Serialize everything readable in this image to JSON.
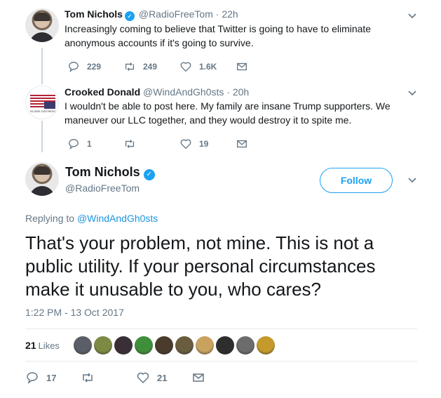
{
  "tweets": [
    {
      "name": "Tom Nichols",
      "verified": true,
      "handle": "@RadioFreeTom",
      "separator": "·",
      "time": "22h",
      "text": "Increasingly coming to believe that Twitter is going to have to eliminate anonymous accounts if it's going to survive.",
      "replies": "229",
      "retweets": "249",
      "likes": "1.6K"
    },
    {
      "name": "Crooked Donald",
      "verified": false,
      "handle": "@WindAndGh0sts",
      "separator": "·",
      "time": "20h",
      "avatar_caption": "IN DIRE DISTRESS",
      "text": "I wouldn't be able to post here. My family are insane Trump supporters. We maneuver our LLC together, and they would destroy it to spite me.",
      "replies": "1",
      "retweets": "",
      "likes": "19"
    }
  ],
  "main_tweet": {
    "name": "Tom Nichols",
    "verified": true,
    "handle": "@RadioFreeTom",
    "follow_label": "Follow",
    "replying_prefix": "Replying to ",
    "replying_to": "@WindAndGh0sts",
    "text": "That's your problem, not mine. This is not a public utility. If your personal circumstances make it unusable to you, who cares?",
    "timestamp": "1:22 PM - 13 Oct 2017",
    "likes_count": "21",
    "likes_label": "Likes",
    "liker_colors": [
      "#5b5e66",
      "#7d8a44",
      "#3a2f36",
      "#3f8f3a",
      "#4b3b2c",
      "#6a5d3f",
      "#c9a25f",
      "#2d2d2d",
      "#6c6c6c",
      "#c59a2c"
    ],
    "replies": "17",
    "retweets": "",
    "likes": "21"
  },
  "colors": {
    "accent": "#1da1f2",
    "muted": "#657786",
    "text": "#14171a",
    "divider": "#e6ecf0"
  },
  "icons": [
    "chevron-down-icon",
    "verified-icon",
    "reply-icon",
    "retweet-icon",
    "like-icon",
    "dm-icon"
  ]
}
